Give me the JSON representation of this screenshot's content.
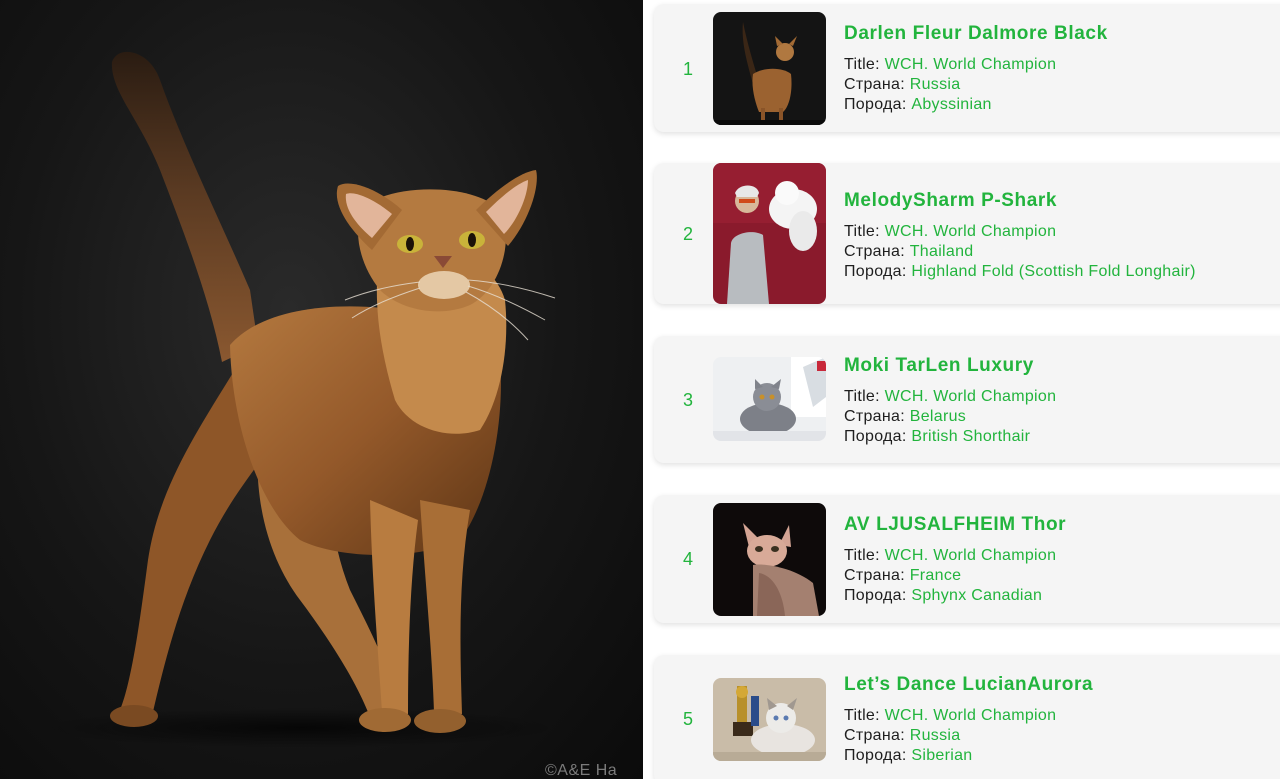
{
  "hero": {
    "credit": "©A&E Ha"
  },
  "colors": {
    "accent_green": "#22b43d",
    "card_bg": "#f5f5f5",
    "label_text": "#1e1e1e"
  },
  "list": {
    "items": [
      {
        "rank": "1",
        "name": "Darlen Fleur Dalmore Black",
        "title_label": "Title:",
        "title_value": "WCH. World Champion",
        "country_label": "Страна:",
        "country_value": "Russia",
        "breed_label": "Порода:",
        "breed_value": "Abyssinian",
        "thumb_icon": "abyssinian-cat-photo"
      },
      {
        "rank": "2",
        "name": "MelodySharm P-Shark",
        "title_label": "Title:",
        "title_value": "WCH. World Champion",
        "country_label": "Страна:",
        "country_value": "Thailand",
        "breed_label": "Порода:",
        "breed_value": "Highland Fold (Scottish Fold Longhair)",
        "thumb_icon": "owner-holding-white-cat-photo"
      },
      {
        "rank": "3",
        "name": "Moki TarLen Luxury",
        "title_label": "Title:",
        "title_value": "WCH. World Champion",
        "country_label": "Страна:",
        "country_value": "Belarus",
        "breed_label": "Порода:",
        "breed_value": "British Shorthair",
        "thumb_icon": "grey-british-cat-photo"
      },
      {
        "rank": "4",
        "name": "AV LJUSALFHEIM Thor",
        "title_label": "Title:",
        "title_value": "WCH. World Champion",
        "country_label": "Страна:",
        "country_value": "France",
        "breed_label": "Порода:",
        "breed_value": "Sphynx Canadian",
        "thumb_icon": "sphynx-cat-photo"
      },
      {
        "rank": "5",
        "name": "Let’s Dance LucianAurora",
        "title_label": "Title:",
        "title_value": "WCH. World Champion",
        "country_label": "Страна:",
        "country_value": "Russia",
        "breed_label": "Порода:",
        "breed_value": "Siberian",
        "thumb_icon": "siberian-cat-with-trophy-photo"
      }
    ]
  }
}
